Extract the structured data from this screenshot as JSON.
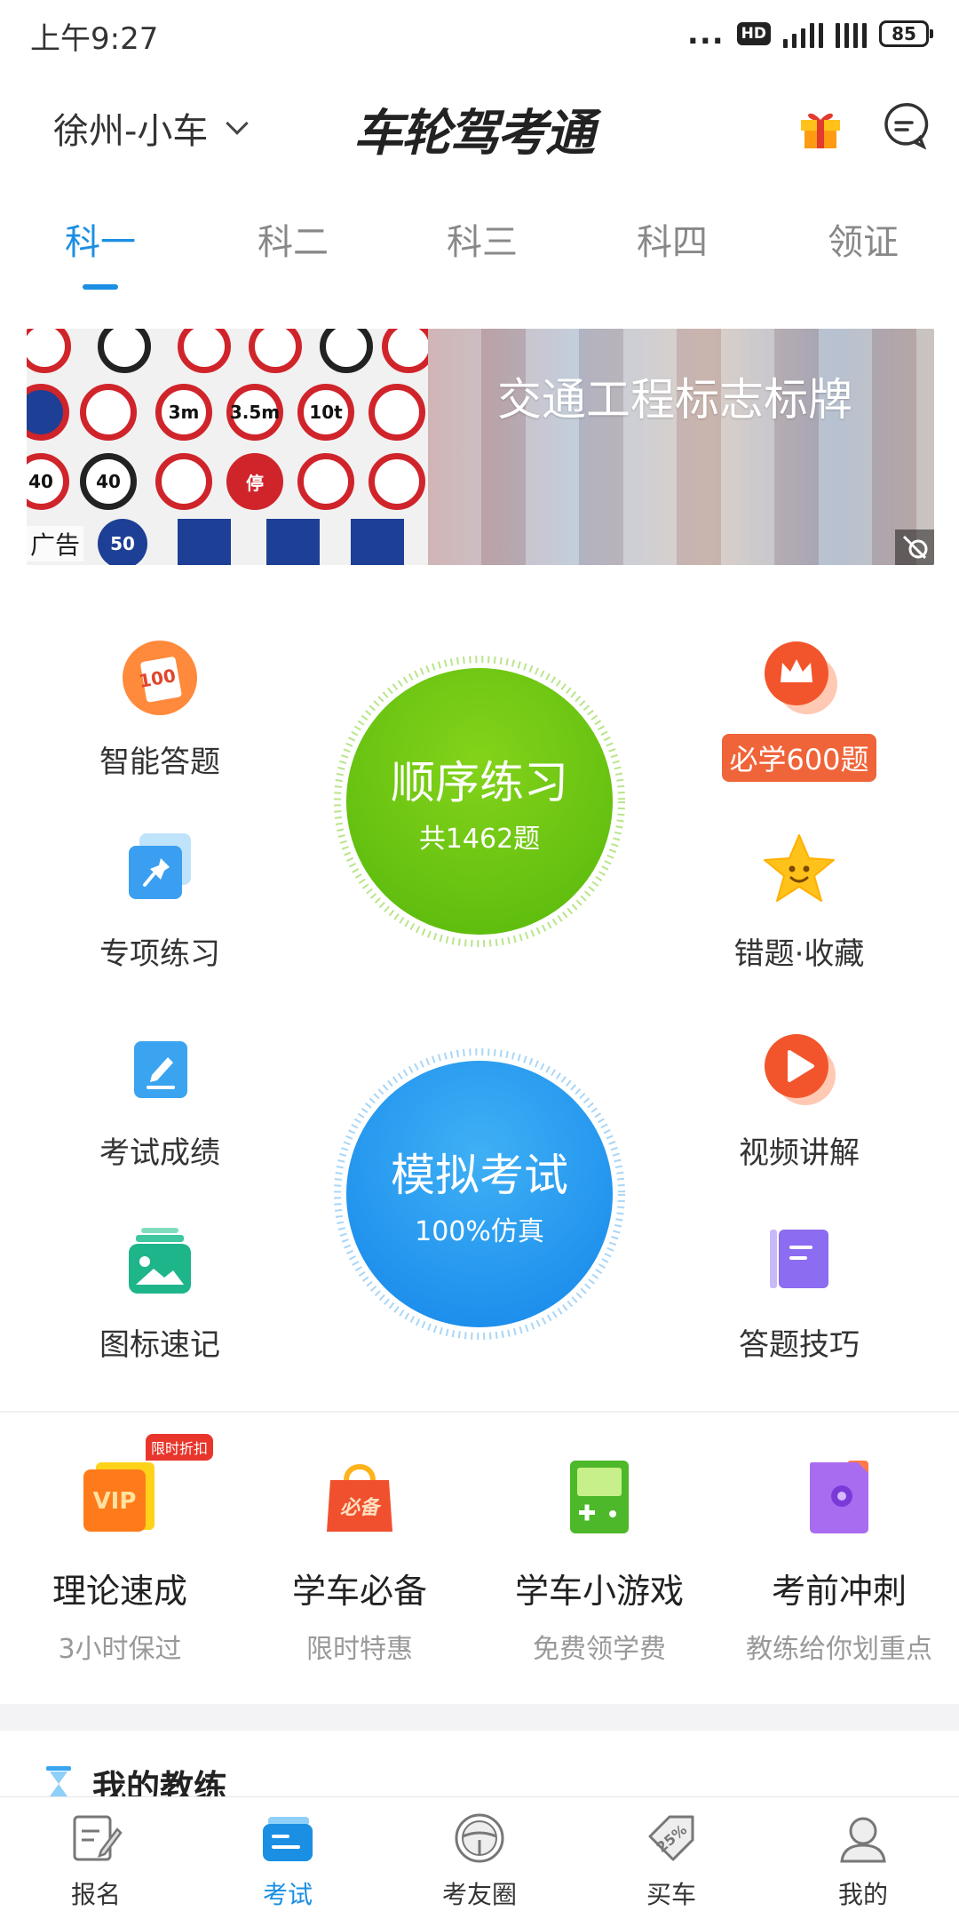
{
  "status_bar": {
    "time": "上午9:27",
    "network": "HD",
    "battery": "85"
  },
  "header": {
    "city": "徐州-小车",
    "logo_text": "车轮驾考通"
  },
  "tabs": [
    {
      "label": "科一",
      "active": true
    },
    {
      "label": "科二",
      "active": false
    },
    {
      "label": "科三",
      "active": false
    },
    {
      "label": "科四",
      "active": false
    },
    {
      "label": "领证",
      "active": false
    }
  ],
  "banner": {
    "title": "交通工程标志标牌",
    "ad_label": "广告",
    "signs": [
      "3m",
      "3.5m",
      "10t",
      "40",
      "40",
      "50",
      "停"
    ]
  },
  "features": {
    "smart_answer": "智能答题",
    "special_practice": "专项练习",
    "exam_scores": "考试成绩",
    "icon_memory": "图标速记",
    "must_learn_600": "必学600题",
    "mistakes_favorites": "错题·收藏",
    "video_explain": "视频讲解",
    "answer_tips": "答题技巧",
    "icon_100": "100"
  },
  "sequential": {
    "title": "顺序练习",
    "subtitle": "共1462题"
  },
  "mock_exam": {
    "title": "模拟考试",
    "subtitle": "100%仿真"
  },
  "promos": [
    {
      "title": "理论速成",
      "subtitle": "3小时保过",
      "badge": "限时折扣",
      "icon_text": "VIP"
    },
    {
      "title": "学车必备",
      "subtitle": "限时特惠",
      "icon_text": "必备"
    },
    {
      "title": "学车小游戏",
      "subtitle": "免费领学费"
    },
    {
      "title": "考前冲刺",
      "subtitle": "教练给你划重点"
    }
  ],
  "section": {
    "my_coach": "我的教练"
  },
  "bottom_nav": [
    {
      "label": "报名",
      "active": false
    },
    {
      "label": "考试",
      "active": true
    },
    {
      "label": "考友圈",
      "active": false
    },
    {
      "label": "买车",
      "active": false,
      "icon_text": "25%"
    },
    {
      "label": "我的",
      "active": false
    }
  ],
  "colors": {
    "accent": "#1a8fe3",
    "green": "#5cc20f",
    "blue": "#1e96ef",
    "orange": "#f06439"
  }
}
